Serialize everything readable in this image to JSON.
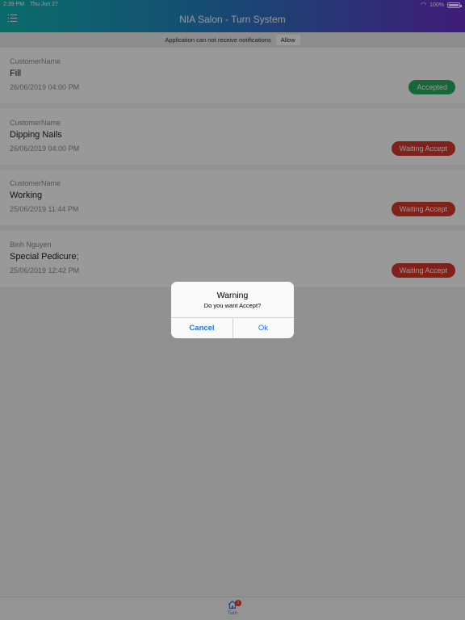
{
  "status_bar": {
    "time": "2:39 PM",
    "date": "Thu Jun 27",
    "battery": "100%"
  },
  "header": {
    "title": "NIA Salon - Turn System"
  },
  "notification_bar": {
    "message": "Application can not receive notifications",
    "allow_label": "Allow"
  },
  "turns": [
    {
      "customer": "CustomerName",
      "service": "Fill",
      "datetime": "26/06/2019 04:00 PM",
      "status": "Accepted"
    },
    {
      "customer": "CustomerName",
      "service": "Dipping Nails",
      "datetime": "26/06/2019 04:00 PM",
      "status": "Waiting Accept"
    },
    {
      "customer": "CustomerName",
      "service": "Working",
      "datetime": "25/06/2019 11:44 PM",
      "status": "Waiting Accept"
    },
    {
      "customer": "Binh Nguyen",
      "service": "Special Pedicure;",
      "datetime": "25/06/2019 12:42 PM",
      "status": "Waiting Accept"
    }
  ],
  "tab_bar": {
    "turn_label": "Turn",
    "turn_badge": "1"
  },
  "alert": {
    "title": "Warning",
    "message": "Do you want Accept?",
    "cancel_label": "Cancel",
    "ok_label": "Ok"
  },
  "colors": {
    "accepted": "#27ae60",
    "waiting": "#d63a2c",
    "link": "#1a73e8",
    "header_start": "#0fb5b2",
    "header_end": "#6a2fc8"
  },
  "icons": {
    "menu": "menu-list-icon",
    "wifi": "wifi-icon",
    "battery": "battery-icon",
    "home": "home-icon"
  }
}
